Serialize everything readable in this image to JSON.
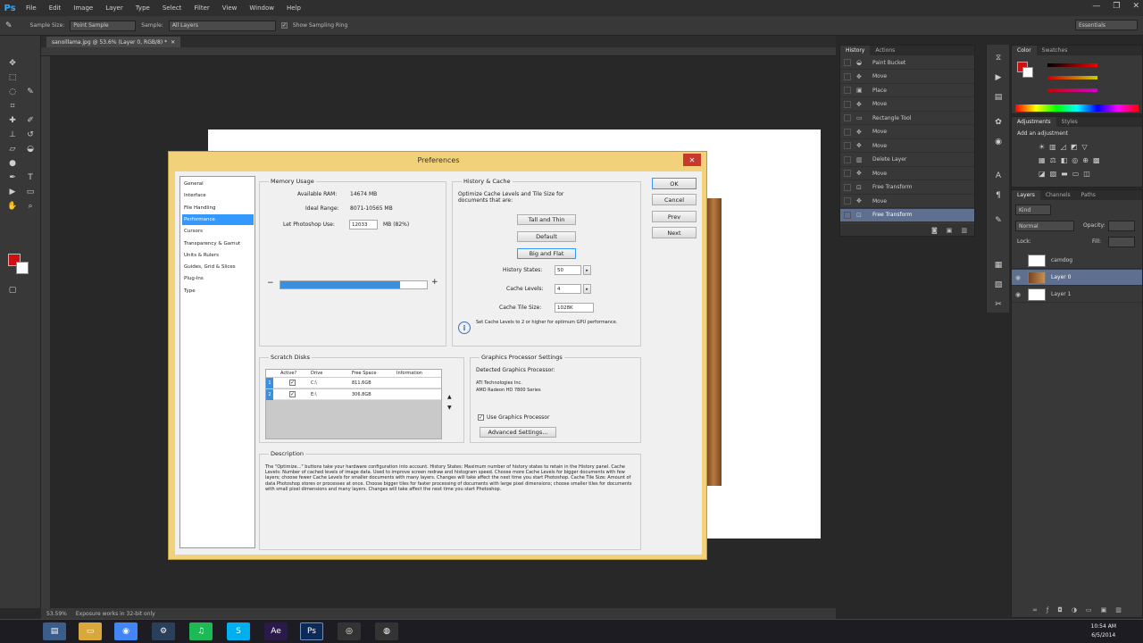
{
  "menubar": {
    "logo": "Ps",
    "items": [
      "File",
      "Edit",
      "Image",
      "Layer",
      "Type",
      "Select",
      "Filter",
      "View",
      "Window",
      "Help"
    ],
    "window_buttons": [
      "—",
      "❐",
      "✕"
    ]
  },
  "options_bar": {
    "sample_size_label": "Sample Size:",
    "sample_size_value": "Point Sample",
    "sample_label": "Sample:",
    "sample_value": "All Layers",
    "show_ring_label": "Show Sampling Ring",
    "workspace": "Essentials"
  },
  "document_tab": {
    "label": "sanoillama.jpg @ 53.6% (Layer 0, RGB/8) *",
    "close": "✕"
  },
  "status_bar": {
    "zoom": "53.59%",
    "info": "Exposure works in 32-bit only"
  },
  "history_panel": {
    "tabs": [
      "History",
      "Actions"
    ],
    "rows": [
      "Paint Bucket",
      "Move",
      "Place",
      "Move",
      "Rectangle Tool",
      "Move",
      "Move",
      "Delete Layer",
      "Move",
      "Free Transform",
      "Move",
      "Free Transform"
    ],
    "selected_index": 11
  },
  "color_panel": {
    "tabs": [
      "Color",
      "Swatches"
    ],
    "fg_color": "#d01010"
  },
  "adjustments_panel": {
    "tabs": [
      "Adjustments",
      "Styles"
    ],
    "title": "Add an adjustment"
  },
  "layers_panel": {
    "tabs": [
      "Layers",
      "Channels",
      "Paths"
    ],
    "kind_label": "Kind",
    "blend_mode": "Normal",
    "opacity_label": "Opacity:",
    "lock_label": "Lock:",
    "fill_label": "Fill:",
    "layers": [
      {
        "name": "camdog",
        "selected": false
      },
      {
        "name": "Layer 0",
        "selected": true
      },
      {
        "name": "Layer 1",
        "selected": false
      }
    ]
  },
  "dialog": {
    "title": "Preferences",
    "close": "✕",
    "nav": [
      "General",
      "Interface",
      "File Handling",
      "Performance",
      "Cursors",
      "Transparency & Gamut",
      "Units & Rulers",
      "Guides, Grid & Slices",
      "Plug-Ins",
      "Type"
    ],
    "nav_selected": 3,
    "buttons": {
      "ok": "OK",
      "cancel": "Cancel",
      "prev": "Prev",
      "next": "Next"
    },
    "memory": {
      "title": "Memory Usage",
      "available_label": "Available RAM:",
      "available_value": "14674 MB",
      "ideal_label": "Ideal Range:",
      "ideal_value": "8071-10565 MB",
      "let_label": "Let Photoshop Use:",
      "let_value": "12033",
      "let_unit": "MB (82%)",
      "minus": "−",
      "plus": "+",
      "slider_fraction": 0.82
    },
    "history_cache": {
      "title": "History & Cache",
      "intro": "Optimize Cache Levels and Tile Size for documents that are:",
      "btn_tall": "Tall and Thin",
      "btn_default": "Default",
      "btn_big": "Big and Flat",
      "states_label": "History States:",
      "states_value": "50",
      "levels_label": "Cache Levels:",
      "levels_value": "4",
      "tile_label": "Cache Tile Size:",
      "tile_value": "1028K",
      "note": "Set Cache Levels to 2 or higher for optimum GPU performance."
    },
    "scratch": {
      "title": "Scratch Disks",
      "headers": [
        "Active?",
        "Drive",
        "Free Space",
        "Information"
      ],
      "rows": [
        {
          "num": "1",
          "drive": "C:\\",
          "free": "811.6GB"
        },
        {
          "num": "2",
          "drive": "E:\\",
          "free": "306.8GB"
        }
      ]
    },
    "gpu": {
      "title": "Graphics Processor Settings",
      "detected_label": "Detected Graphics Processor:",
      "vendor": "ATI Technologies Inc.",
      "model": "AMD Radeon HD 7800 Series",
      "use_label": "Use Graphics Processor",
      "advanced_btn": "Advanced Settings..."
    },
    "description": {
      "title": "Description",
      "text": "The \"Optimize...\" buttons take your hardware configuration into account. History States: Maximum number of history states to retain in the History panel. Cache Levels: Number of cached levels of image data. Used to improve screen redraw and histogram speed. Choose more Cache Levels for bigger documents with few layers; choose fewer Cache Levels for smaller documents with many layers. Changes will take affect the next time you start Photoshop. Cache Tile Size: Amount of data Photoshop stores or processes at once. Choose bigger tiles for faster processing of documents with large pixel dimensions; choose smaller tiles for documents with small pixel dimensions and many layers. Changes will take affect the next time you start Photoshop."
    }
  },
  "taskbar": {
    "time": "10:54 AM",
    "date": "6/5/2014"
  }
}
